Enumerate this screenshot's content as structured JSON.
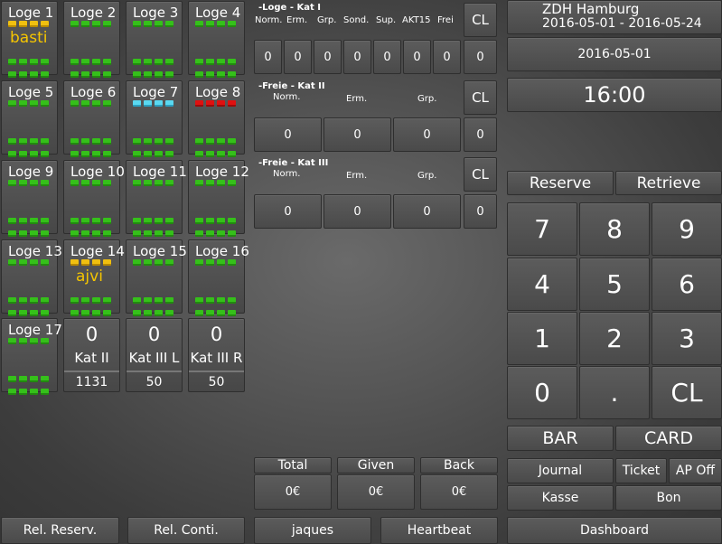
{
  "loges": [
    {
      "name": "Loge 1",
      "holder": "basti",
      "rows": [
        [
          "y",
          "y",
          "y",
          "y"
        ],
        [
          "g",
          "g",
          "g",
          "g"
        ],
        [
          "g",
          "g",
          "g",
          "g"
        ]
      ]
    },
    {
      "name": "Loge 2",
      "holder": "",
      "rows": [
        [
          "g",
          "g",
          "g",
          "g"
        ],
        [
          "g",
          "g",
          "g",
          "g"
        ],
        [
          "g",
          "g",
          "g",
          "g"
        ]
      ]
    },
    {
      "name": "Loge 3",
      "holder": "",
      "rows": [
        [
          "g",
          "g",
          "g",
          "g"
        ],
        [
          "g",
          "g",
          "g",
          "g"
        ],
        [
          "g",
          "g",
          "g",
          "g"
        ]
      ]
    },
    {
      "name": "Loge 4",
      "holder": "",
      "rows": [
        [
          "g",
          "g",
          "g",
          "g"
        ],
        [
          "g",
          "g",
          "g",
          "g"
        ],
        [
          "g",
          "g",
          "g",
          "g"
        ]
      ]
    },
    {
      "name": "Loge 5",
      "holder": "",
      "rows": [
        [
          "g",
          "g",
          "g",
          "g"
        ],
        [
          "g",
          "g",
          "g",
          "g"
        ],
        [
          "g",
          "g",
          "g",
          "g"
        ]
      ]
    },
    {
      "name": "Loge 6",
      "holder": "",
      "rows": [
        [
          "g",
          "g",
          "g",
          "g"
        ],
        [
          "g",
          "g",
          "g",
          "g"
        ],
        [
          "g",
          "g",
          "g",
          "g"
        ]
      ]
    },
    {
      "name": "Loge 7",
      "holder": "",
      "rows": [
        [
          "c",
          "c",
          "c",
          "c"
        ],
        [
          "g",
          "g",
          "g",
          "g"
        ],
        [
          "g",
          "g",
          "g",
          "g"
        ]
      ]
    },
    {
      "name": "Loge 8",
      "holder": "",
      "rows": [
        [
          "r",
          "r",
          "r",
          "r"
        ],
        [
          "g",
          "g",
          "g",
          "g"
        ],
        [
          "g",
          "g",
          "g",
          "g"
        ]
      ]
    },
    {
      "name": "Loge 9",
      "holder": "",
      "rows": [
        [
          "g",
          "g",
          "g",
          "g"
        ],
        [
          "g",
          "g",
          "g",
          "g"
        ],
        [
          "g",
          "g",
          "g",
          "g"
        ]
      ]
    },
    {
      "name": "Loge 10",
      "holder": "",
      "rows": [
        [
          "g",
          "g",
          "g",
          "g"
        ],
        [
          "g",
          "g",
          "g",
          "g"
        ],
        [
          "g",
          "g",
          "g",
          "g"
        ]
      ]
    },
    {
      "name": "Loge 11",
      "holder": "",
      "rows": [
        [
          "g",
          "g",
          "g",
          "g"
        ],
        [
          "g",
          "g",
          "g",
          "g"
        ],
        [
          "g",
          "g",
          "g",
          "g"
        ]
      ]
    },
    {
      "name": "Loge 12",
      "holder": "",
      "rows": [
        [
          "g",
          "g",
          "g",
          "g"
        ],
        [
          "g",
          "g",
          "g",
          "g"
        ],
        [
          "g",
          "g",
          "g",
          "g"
        ]
      ]
    },
    {
      "name": "Loge 13",
      "holder": "",
      "rows": [
        [
          "g",
          "g",
          "g",
          "g"
        ],
        [
          "g",
          "g",
          "g",
          "g"
        ],
        [
          "g",
          "g",
          "g",
          "g"
        ]
      ]
    },
    {
      "name": "Loge 14",
      "holder": "ajvi",
      "rows": [
        [
          "y",
          "y",
          "y",
          "y"
        ],
        [
          "g",
          "g",
          "g",
          "g"
        ],
        [
          "g",
          "g",
          "g",
          "g"
        ]
      ]
    },
    {
      "name": "Loge 15",
      "holder": "",
      "rows": [
        [
          "g",
          "g",
          "g",
          "g"
        ],
        [
          "g",
          "g",
          "g",
          "g"
        ],
        [
          "g",
          "g",
          "g",
          "g"
        ]
      ]
    },
    {
      "name": "Loge 16",
      "holder": "",
      "rows": [
        [
          "g",
          "g",
          "g",
          "g"
        ],
        [
          "g",
          "g",
          "g",
          "g"
        ],
        [
          "g",
          "g",
          "g",
          "g"
        ]
      ]
    },
    {
      "name": "Loge 17",
      "holder": "",
      "rows": [
        [
          "g",
          "g",
          "g",
          "g"
        ],
        [
          "g",
          "g",
          "g",
          "g"
        ],
        [
          "g",
          "g",
          "g",
          "g"
        ]
      ]
    }
  ],
  "kat_tiles": [
    {
      "count": "0",
      "name": "Kat II",
      "capacity": "1131"
    },
    {
      "count": "0",
      "name": "Kat III L",
      "capacity": "50"
    },
    {
      "count": "0",
      "name": "Kat III R",
      "capacity": "50"
    }
  ],
  "seat_colors": {
    "g": "#35c01a",
    "y": "#f0c010",
    "c": "#5ad8f0",
    "r": "#e01010"
  },
  "loge_kat1": {
    "title": "-Loge - Kat I",
    "columns": [
      "Norm.",
      "Erm.",
      "Grp.",
      "Sond.",
      "Sup.",
      "AKT15",
      "Frei"
    ],
    "values": [
      "0",
      "0",
      "0",
      "0",
      "0",
      "0",
      "0"
    ],
    "clear_label": "CL",
    "sum": "0"
  },
  "freie_kat2": {
    "title": "-Freie - Kat II",
    "columns": [
      "Norm.",
      "Erm.",
      "Grp."
    ],
    "values": [
      "0",
      "0",
      "0"
    ],
    "clear_label": "CL",
    "sum": "0"
  },
  "freie_kat3": {
    "title": "-Freie - Kat III",
    "columns": [
      "Norm.",
      "Erm.",
      "Grp."
    ],
    "values": [
      "0",
      "0",
      "0"
    ],
    "clear_label": "CL",
    "sum": "0"
  },
  "payment": {
    "total_label": "Total",
    "total_value": "0€",
    "given_label": "Given",
    "given_value": "0€",
    "back_label": "Back",
    "back_value": "0€"
  },
  "bottom_left": {
    "rel_reserv": "Rel. Reserv.",
    "rel_conti": "Rel. Conti.",
    "user": "jaques",
    "heartbeat": "Heartbeat"
  },
  "header": {
    "venue": "ZDH Hamburg",
    "date_range": "2016-05-01 - 2016-05-24",
    "date": "2016-05-01",
    "time": "16:00"
  },
  "actions": {
    "reserve": "Reserve",
    "retrieve": "Retrieve",
    "bar": "BAR",
    "card": "CARD",
    "journal": "Journal",
    "ticket": "Ticket",
    "ap_off": "AP Off",
    "kasse": "Kasse",
    "bon": "Bon",
    "dashboard": "Dashboard"
  },
  "keypad": [
    "7",
    "8",
    "9",
    "4",
    "5",
    "6",
    "1",
    "2",
    "3",
    "0",
    ".",
    "CL"
  ]
}
